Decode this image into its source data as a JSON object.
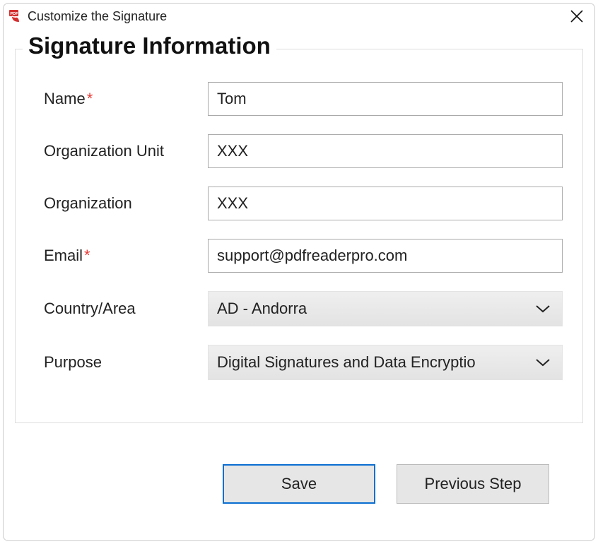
{
  "window": {
    "title": "Customize the Signature"
  },
  "section": {
    "legend": "Signature Information"
  },
  "fields": {
    "name": {
      "label": "Name",
      "required": "*",
      "value": "Tom"
    },
    "orgUnit": {
      "label": "Organization Unit",
      "value": "XXX"
    },
    "org": {
      "label": "Organization",
      "value": "XXX"
    },
    "email": {
      "label": "Email",
      "required": "*",
      "value": "support@pdfreaderpro.com"
    },
    "country": {
      "label": "Country/Area",
      "value": "AD - Andorra"
    },
    "purpose": {
      "label": "Purpose",
      "value": "Digital Signatures and Data Encryptio"
    }
  },
  "buttons": {
    "save": "Save",
    "prev": "Previous Step"
  }
}
